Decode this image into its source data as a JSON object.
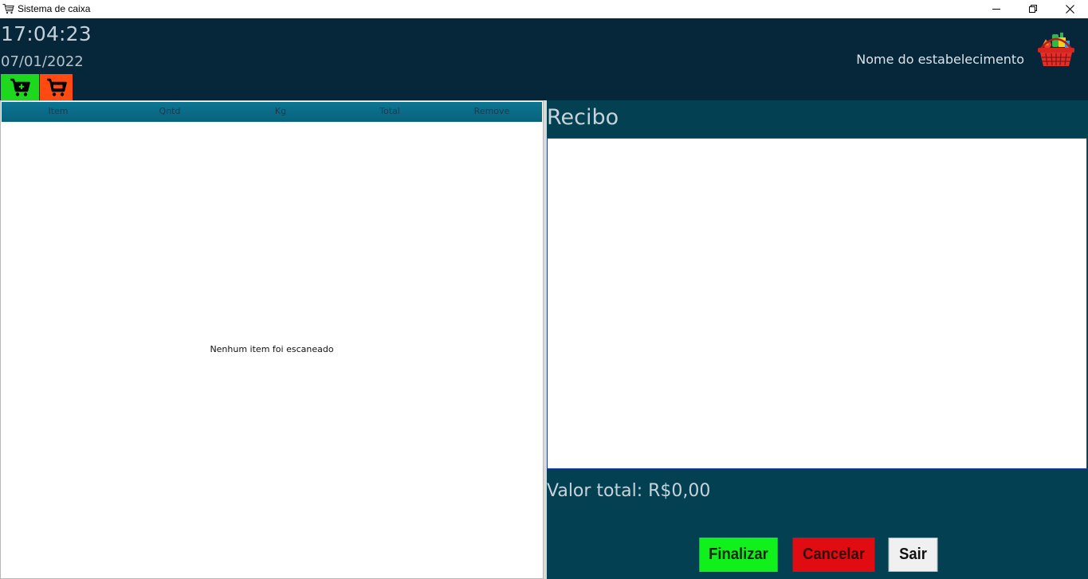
{
  "window": {
    "title": "Sistema de caixa",
    "controls": [
      "minimize-icon",
      "restore-icon",
      "close-icon"
    ]
  },
  "header": {
    "time": "17:04:23",
    "date": "07/01/2022",
    "establishment_name": "Nome do estabelecimento",
    "cart_buttons": [
      {
        "icon": "cart-add-icon",
        "color": "#1ed81e"
      },
      {
        "icon": "cart-remove-icon",
        "color": "#ff4a12"
      }
    ],
    "logo_icon": "shopping-basket-icon"
  },
  "items_table": {
    "columns": [
      "Item",
      "Qntd",
      "Kg",
      "Total",
      "Remove"
    ],
    "rows": [],
    "empty_message": "Nenhum item foi escaneado"
  },
  "receipt": {
    "title": "Recibo",
    "content": "",
    "total_label": "Valor total: R$0,00"
  },
  "actions": {
    "finalize": "Finalizar",
    "cancel": "Cancelar",
    "exit": "Sair"
  },
  "colors": {
    "header_bg": "#06263a",
    "panel_bg": "#034052",
    "table_header": "#0c7593",
    "finalize": "#10f01a",
    "cancel": "#e00c12"
  }
}
